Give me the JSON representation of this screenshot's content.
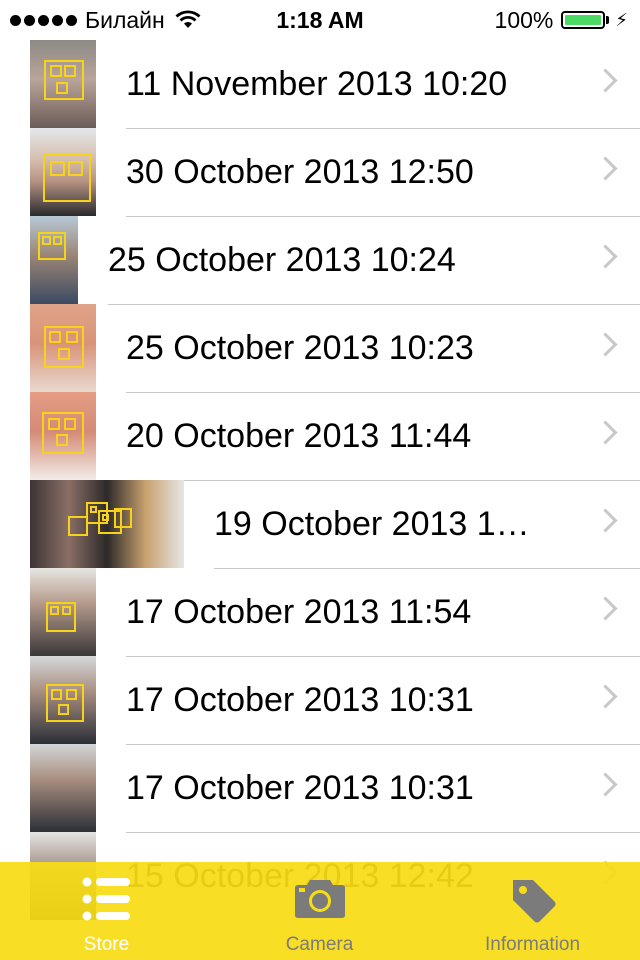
{
  "status_bar": {
    "carrier": "Билайн",
    "time": "1:18 AM",
    "battery": "100%",
    "battery_color": "#4cd964"
  },
  "list": {
    "rows": [
      {
        "label": "11 November 2013 10:20",
        "thumb": "face-photo-icon"
      },
      {
        "label": "30 October 2013 12:50",
        "thumb": "face-photo-icon"
      },
      {
        "label": "25 October 2013 10:24",
        "thumb": "face-photo-icon"
      },
      {
        "label": "25 October 2013 10:23",
        "thumb": "face-photo-icon"
      },
      {
        "label": "20 October 2013 11:44",
        "thumb": "face-photo-icon"
      },
      {
        "label": "19 October 2013 1…",
        "thumb": "group-photo-icon"
      },
      {
        "label": "17 October 2013 11:54",
        "thumb": "face-photo-icon"
      },
      {
        "label": "17 October 2013 10:31",
        "thumb": "face-photo-icon"
      },
      {
        "label": "17 October 2013 10:31",
        "thumb": "face-photo-icon"
      },
      {
        "label": "15 October 2013 12:42",
        "thumb": "face-photo-icon"
      }
    ]
  },
  "tab_bar": {
    "accent": "#f7dd16",
    "tabs": [
      {
        "label": "Store",
        "icon": "list-icon",
        "active": true
      },
      {
        "label": "Camera",
        "icon": "camera-icon",
        "active": false
      },
      {
        "label": "Information",
        "icon": "tag-icon",
        "active": false
      }
    ]
  }
}
